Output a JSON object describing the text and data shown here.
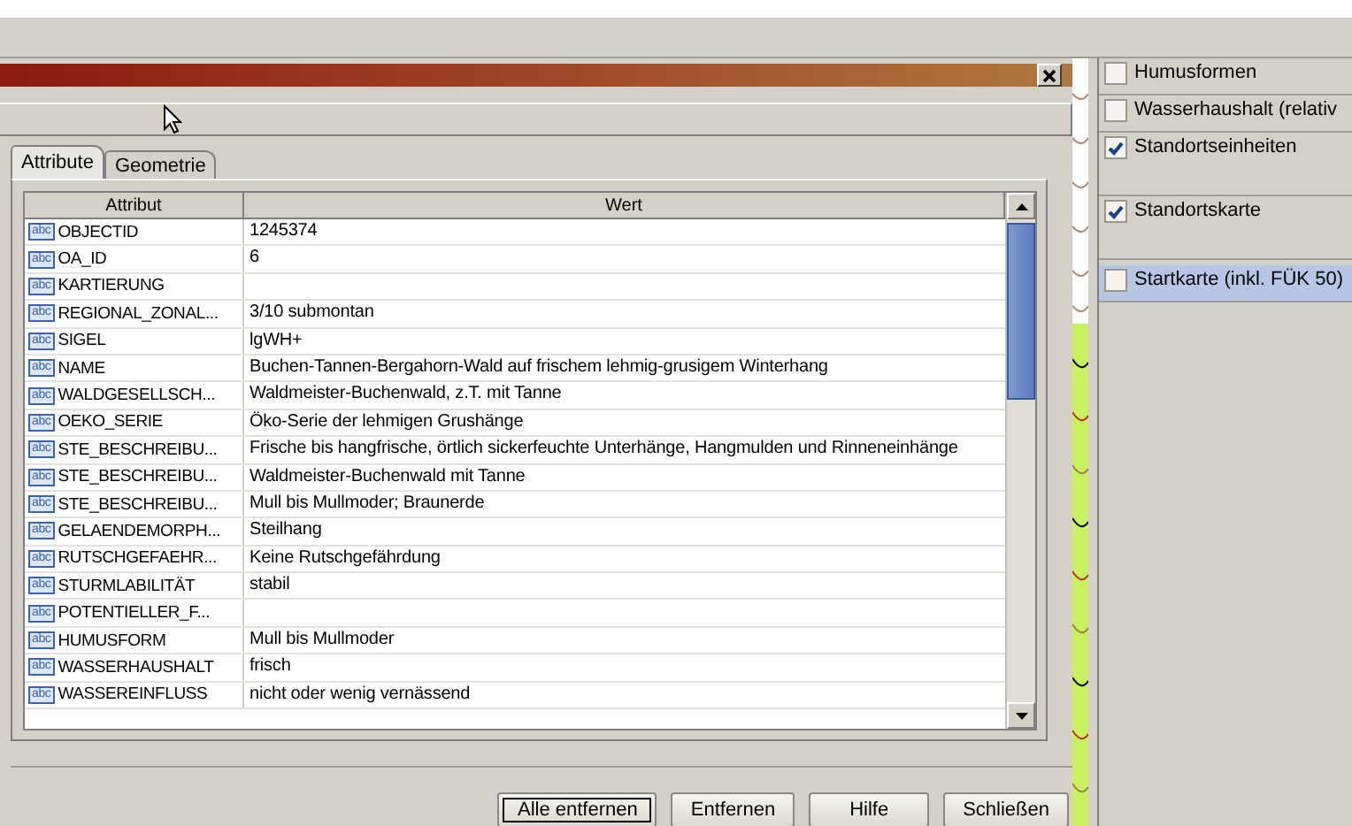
{
  "dialog": {
    "tabs": [
      {
        "label": "Attribute",
        "selected": true
      },
      {
        "label": "Geometrie",
        "selected": false
      }
    ],
    "table": {
      "columns": [
        "Attribut",
        "Wert"
      ],
      "rows": [
        {
          "type": "abc",
          "attribute": "OBJECTID",
          "value": "1245374"
        },
        {
          "type": "abc",
          "attribute": "OA_ID",
          "value": "6"
        },
        {
          "type": "abc",
          "attribute": "KARTIERUNG",
          "value": ""
        },
        {
          "type": "abc",
          "attribute": "REGIONAL_ZONAL...",
          "value": "3/10 submontan"
        },
        {
          "type": "abc",
          "attribute": "SIGEL",
          "value": "lgWH+"
        },
        {
          "type": "abc",
          "attribute": "NAME",
          "value": "Buchen-Tannen-Bergahorn-Wald auf frischem lehmig-grusigem Winterhang"
        },
        {
          "type": "abc",
          "attribute": "WALDGESELLSCH...",
          "value": "Waldmeister-Buchenwald, z.T. mit Tanne"
        },
        {
          "type": "abc",
          "attribute": "OEKO_SERIE",
          "value": "Öko-Serie der lehmigen Grushänge"
        },
        {
          "type": "abc",
          "attribute": "STE_BESCHREIBU...",
          "value": "Frische bis hangfrische, örtlich sickerfeuchte Unterhänge, Hangmulden und Rinneneinhänge"
        },
        {
          "type": "abc",
          "attribute": "STE_BESCHREIBU...",
          "value": "Waldmeister-Buchenwald mit Tanne"
        },
        {
          "type": "abc",
          "attribute": "STE_BESCHREIBU...",
          "value": "Mull bis Mullmoder; Braunerde"
        },
        {
          "type": "abc",
          "attribute": "GELAENDEMORPH...",
          "value": "Steilhang"
        },
        {
          "type": "abc",
          "attribute": "RUTSCHGEFAEHR...",
          "value": "Keine Rutschgefährdung"
        },
        {
          "type": "abc",
          "attribute": "STURMLABILITÄT",
          "value": "stabil"
        },
        {
          "type": "abc",
          "attribute": "POTENTIELLER_F...",
          "value": ""
        },
        {
          "type": "abc",
          "attribute": "HUMUSFORM",
          "value": "Mull bis Mullmoder"
        },
        {
          "type": "abc",
          "attribute": "WASSERHAUSHALT",
          "value": "frisch"
        },
        {
          "type": "abc",
          "attribute": "WASSEREINFLUSS",
          "value": "nicht oder wenig vernässend"
        }
      ]
    },
    "buttons": [
      {
        "label": "Alle entfernen",
        "selected": true
      },
      {
        "label": "Entfernen",
        "selected": false
      },
      {
        "label": "Hilfe",
        "selected": false
      },
      {
        "label": "Schließen",
        "selected": false
      }
    ]
  },
  "layers": [
    {
      "label": "Humusformen",
      "checked": false,
      "selected": false,
      "kind": "short"
    },
    {
      "label": "Wasserhaushalt (relativ",
      "checked": false,
      "selected": false,
      "kind": "short"
    },
    {
      "label": "Standortseinheiten",
      "checked": true,
      "selected": false,
      "kind": "tall"
    },
    {
      "label": "Standortskarte",
      "checked": true,
      "selected": false,
      "kind": "tall"
    },
    {
      "label": "Startkarte (inkl. FÜK 50)",
      "checked": false,
      "selected": true,
      "kind": "short"
    }
  ]
}
